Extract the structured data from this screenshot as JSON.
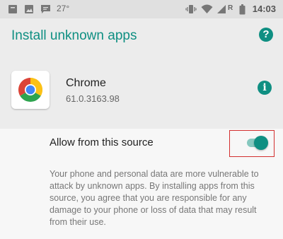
{
  "status_bar": {
    "temperature": "27°",
    "time": "14:03",
    "carrier_letter": "R",
    "left_icons": [
      "notification-icon",
      "image-icon",
      "message-icon"
    ],
    "right_icons": [
      "vibrate-icon",
      "wifi-icon",
      "signal-icon",
      "battery-icon"
    ]
  },
  "header": {
    "title": "Install unknown apps",
    "help_icon": "help-icon"
  },
  "app": {
    "name": "Chrome",
    "version": "61.0.3163.98",
    "icon": "chrome-logo-icon",
    "info_icon": "info-icon"
  },
  "setting": {
    "label": "Allow from this source",
    "enabled": true,
    "description": "Your phone and personal data are more vulnerable to attack by unknown apps. By installing apps from this source, you agree that you are responsible for any damage to your phone or loss of data that may result from their use."
  },
  "colors": {
    "accent": "#0f8f82",
    "highlight": "#d32f2f"
  }
}
